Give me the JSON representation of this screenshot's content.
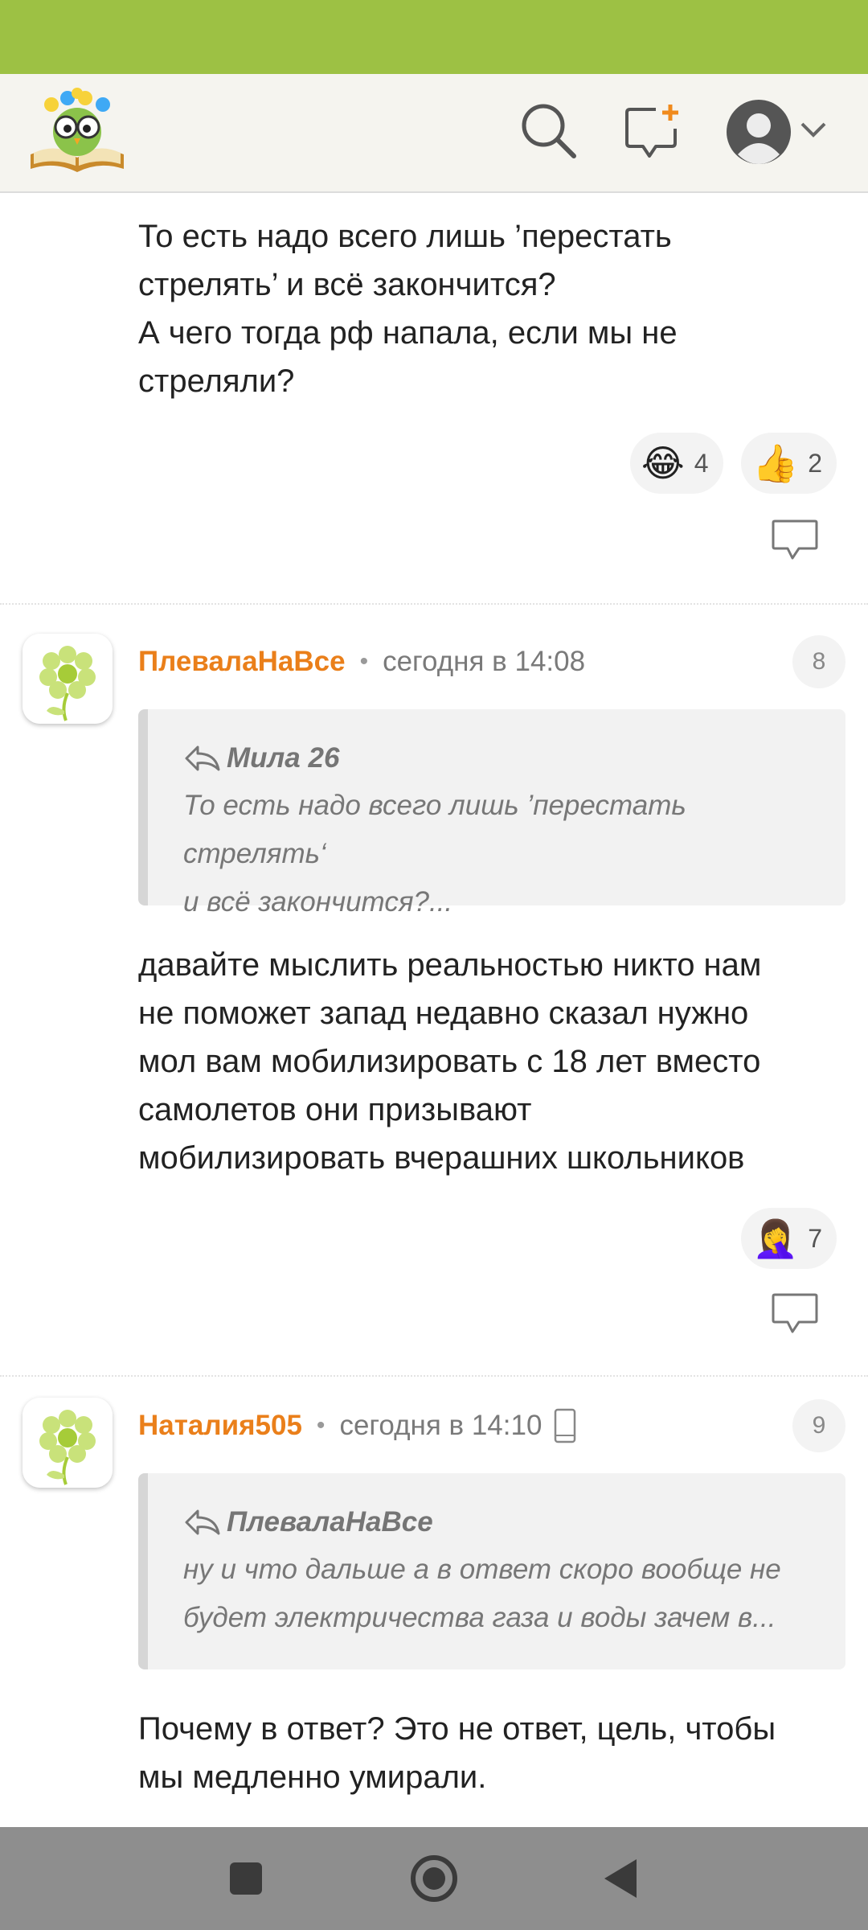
{
  "header": {
    "logo_icon": "owl-book-logo-icon",
    "search_icon": "search-icon",
    "new_post_icon": "new-message-icon",
    "profile_icon": "user-avatar-icon",
    "menu_icon": "chevron-down-icon"
  },
  "comments": [
    {
      "text_lines": [
        "То есть надо всего лишь ’перестать",
        "стрелять’ и всё закончится?",
        "А чего тогда рф напала, если мы не",
        "стреляли?"
      ],
      "reactions": [
        {
          "emoji": "😂",
          "count": "4"
        },
        {
          "emoji": "👍",
          "count": "2"
        }
      ]
    },
    {
      "author": "ПлевалаНаВсе",
      "separator": "•",
      "time": "сегодня в 14:08",
      "number": "8",
      "quote": {
        "author": "Мила 26",
        "lines": [
          "То есть надо всего лишь ’перестать стрелять‘",
          "и всё закончится?..."
        ]
      },
      "text_lines": [
        "давайте мыслить реальностью никто нам",
        "не поможет запад недавно сказал нужно",
        "мол вам мобилизировать с 18 лет вместо",
        "самолетов они призывают",
        "мобилизировать вчерашних школьников"
      ],
      "reactions": [
        {
          "emoji": "🤦‍♀️",
          "count": "7"
        }
      ]
    },
    {
      "author": "Наталия505",
      "separator": "•",
      "time": "сегодня в 14:10",
      "device_icon": "mobile-phone-icon",
      "number": "9",
      "quote": {
        "author": "ПлевалаНаВсе",
        "lines": [
          "ну и что дальше а в ответ скоро вообще не",
          "будет электричества газа и воды зачем в..."
        ]
      },
      "text_lines": [
        "Почему в ответ? Это не ответ, цель, чтобы",
        "мы медленно умирали."
      ]
    }
  ],
  "colors": {
    "status_bar": "#9dc144",
    "author_name": "#ea7f1a",
    "header_bg": "#f5f4ef",
    "nav_bar": "#8e8e8e"
  },
  "navigation": {
    "recents_icon": "square-recents-icon",
    "home_icon": "circle-home-icon",
    "back_icon": "triangle-back-icon"
  }
}
